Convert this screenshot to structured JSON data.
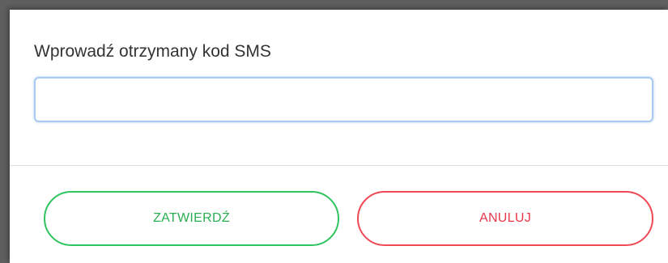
{
  "dialog": {
    "prompt": "Wprowadź otrzymany kod SMS",
    "sms_code_value": "",
    "confirm_label": "ZATWIERDŹ",
    "cancel_label": "ANULUJ"
  },
  "colors": {
    "confirm_accent": "#2fc45f",
    "cancel_accent": "#ef4956",
    "input_focus_border": "#a9c9f0",
    "backdrop": "#5f5f5f"
  }
}
